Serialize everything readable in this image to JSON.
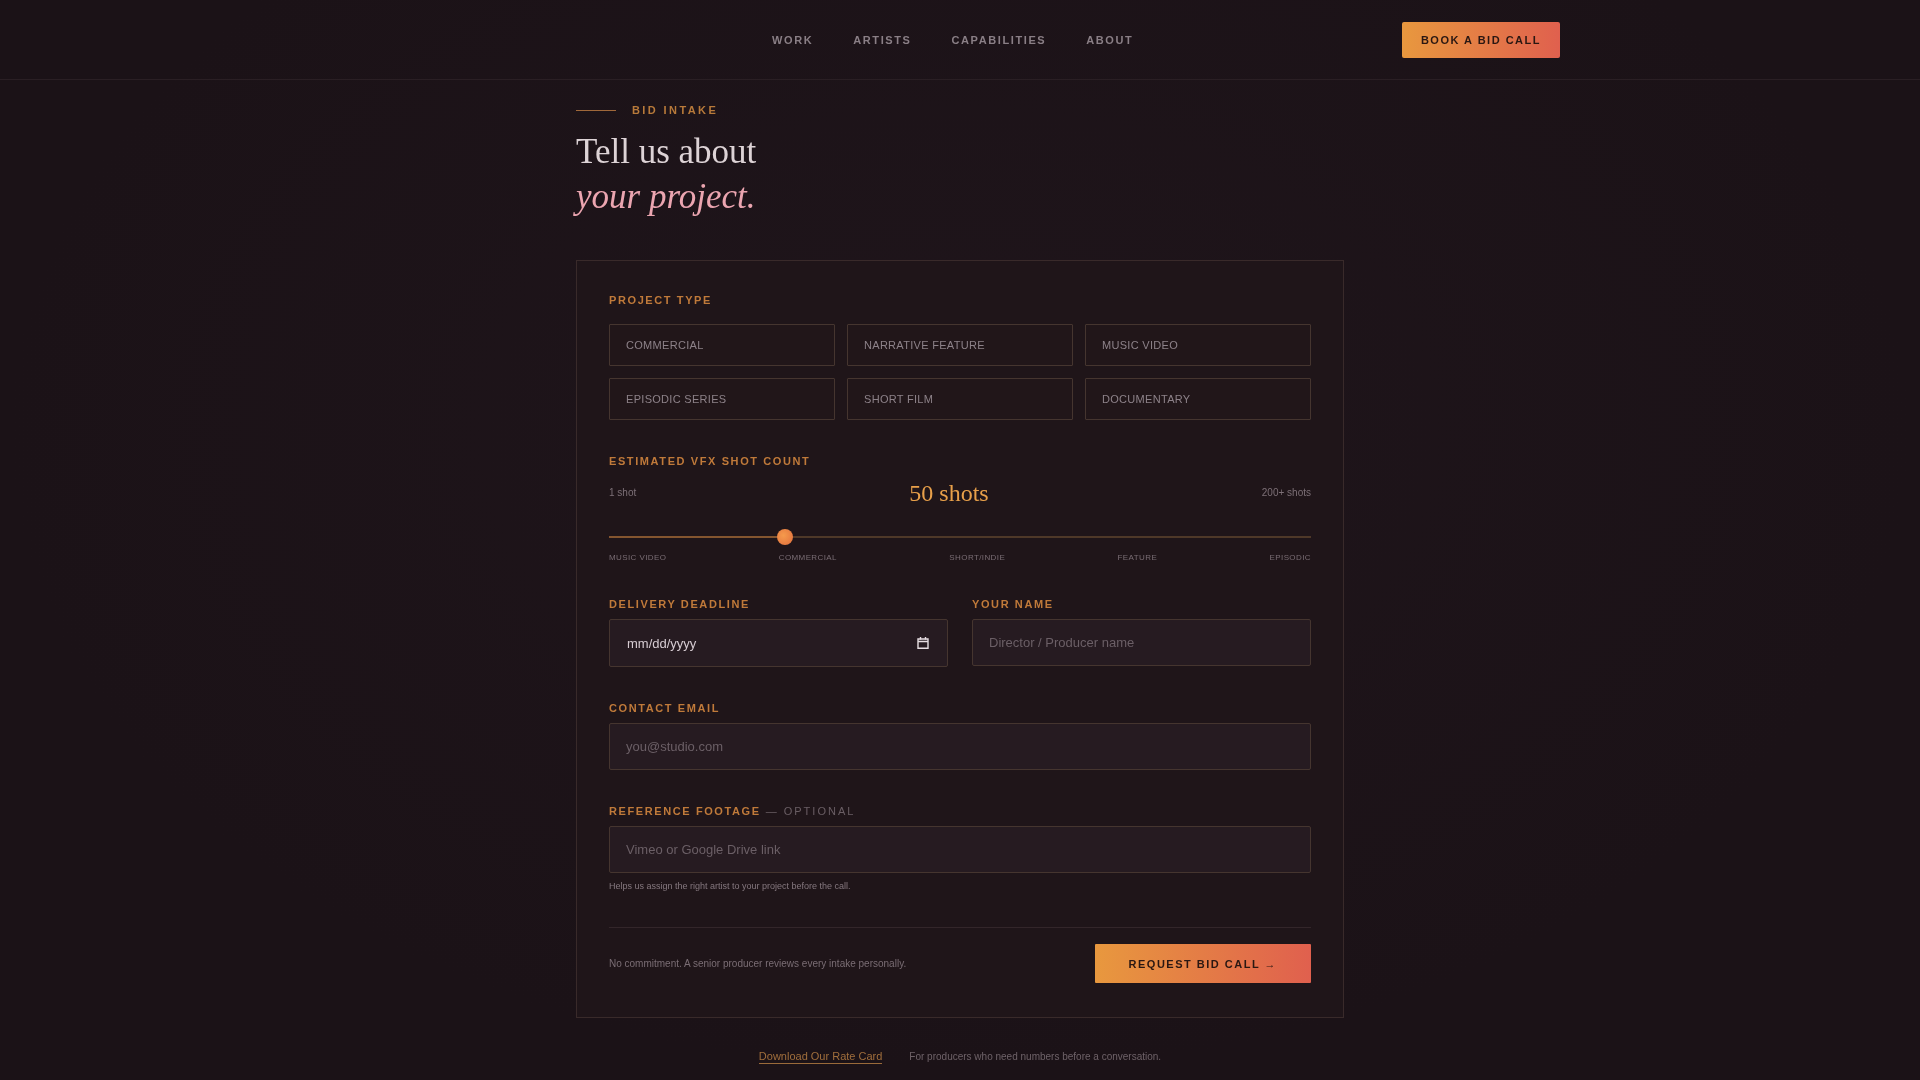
{
  "nav": {
    "links": [
      {
        "label": "WORK"
      },
      {
        "label": "ARTISTS"
      },
      {
        "label": "CAPABILITIES"
      },
      {
        "label": "ABOUT"
      }
    ],
    "cta": "BOOK A BID CALL"
  },
  "intro": {
    "eyebrow": "BID INTAKE",
    "title": "Tell us about",
    "title_accent": "your project."
  },
  "form": {
    "project_type": {
      "label": "PROJECT TYPE",
      "options": [
        {
          "label": "COMMERCIAL",
          "selected": false
        },
        {
          "label": "NARRATIVE FEATURE",
          "selected": false
        },
        {
          "label": "MUSIC VIDEO",
          "selected": false
        },
        {
          "label": "EPISODIC SERIES",
          "selected": false
        },
        {
          "label": "SHORT FILM",
          "selected": false
        },
        {
          "label": "DOCUMENTARY",
          "selected": false
        }
      ]
    },
    "shot_count": {
      "label": "ESTIMATED VFX SHOT COUNT",
      "min_label": "1 shot",
      "value": "50 shots",
      "max_label": "200+ shots",
      "level": 0.25,
      "ticks": [
        "MUSIC VIDEO",
        "COMMERCIAL",
        "SHORT/INDIE",
        "FEATURE",
        "EPISODIC"
      ]
    },
    "delivery_deadline": {
      "label": "DELIVERY DEADLINE",
      "placeholder": "mm/dd/yyyy"
    },
    "your_name": {
      "label": "YOUR NAME",
      "placeholder": "Director / Producer name"
    },
    "contact_email": {
      "label": "CONTACT EMAIL",
      "placeholder": "you@studio.com"
    },
    "reference_footage": {
      "label": "REFERENCE FOOTAGE",
      "note": "— OPTIONAL",
      "placeholder": "Vimeo or Google Drive link",
      "hint": "Helps us assign the right artist to your project before the call."
    },
    "footer_note": "No commitment. A senior producer reviews every intake personally.",
    "submit": "REQUEST BID CALL →"
  },
  "rate_card": {
    "link": "Download Our Rate Card",
    "text": "For producers who need numbers before a conversation."
  }
}
